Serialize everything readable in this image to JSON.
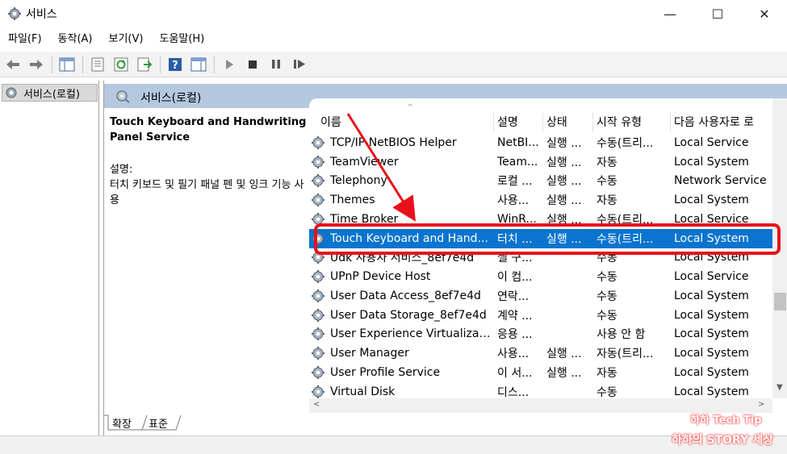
{
  "window": {
    "title": "서비스",
    "minimize": "—",
    "maximize": "☐",
    "close": "✕"
  },
  "menu": [
    "파일(F)",
    "동작(A)",
    "보기(V)",
    "도움말(H)"
  ],
  "tree": {
    "root_label": "서비스(로컬)"
  },
  "panel": {
    "header": "서비스(로컬)",
    "selected_name": "Touch Keyboard and Handwriting\nPanel Service",
    "desc_label": "설명:",
    "desc_text": "터치 키보드 및 필기 패널 펜 및 잉크 기능 사용"
  },
  "columns": [
    "이름",
    "설명",
    "상태",
    "시작 유형",
    "다음 사용자로 로"
  ],
  "rows": [
    {
      "name": "TCP/IP NetBIOS Helper",
      "desc": "NetBI...",
      "state": "실행 ...",
      "start": "수동(트리...",
      "logon": "Local Service"
    },
    {
      "name": "TeamViewer",
      "desc": "Team...",
      "state": "실행 ...",
      "start": "자동",
      "logon": "Local System"
    },
    {
      "name": "Telephony",
      "desc": "로컬 ...",
      "state": "실행 ...",
      "start": "수동",
      "logon": "Network Service"
    },
    {
      "name": "Themes",
      "desc": "사용...",
      "state": "실행 ...",
      "start": "자동",
      "logon": "Local System"
    },
    {
      "name": "Time Broker",
      "desc": "WinR...",
      "state": "실행 ...",
      "start": "수동(트리...",
      "logon": "Local Service"
    },
    {
      "name": "Touch Keyboard and Hand...",
      "desc": "터치 ...",
      "state": "실행 ...",
      "start": "수동(트리...",
      "logon": "Local System"
    },
    {
      "name": "Udk 사용자 서비스_8ef7e4d",
      "desc": "셸 구...",
      "state": "",
      "start": "수동",
      "logon": "Local System"
    },
    {
      "name": "UPnP Device Host",
      "desc": "이 컴...",
      "state": "",
      "start": "수동",
      "logon": "Local Service"
    },
    {
      "name": "User Data Access_8ef7e4d",
      "desc": "연락...",
      "state": "",
      "start": "수동",
      "logon": "Local System"
    },
    {
      "name": "User Data Storage_8ef7e4d",
      "desc": "계약 ...",
      "state": "",
      "start": "수동",
      "logon": "Local System"
    },
    {
      "name": "User Experience Virtualizatio...",
      "desc": "응용 ...",
      "state": "",
      "start": "사용 안 함",
      "logon": "Local System"
    },
    {
      "name": "User Manager",
      "desc": "사용...",
      "state": "실행 ...",
      "start": "자동(트리...",
      "logon": "Local System"
    },
    {
      "name": "User Profile Service",
      "desc": "이 서...",
      "state": "실행 ...",
      "start": "자동",
      "logon": "Local System"
    },
    {
      "name": "Virtual Disk",
      "desc": "디스...",
      "state": "",
      "start": "수동",
      "logon": "Local System"
    }
  ],
  "selected_index": 5,
  "tabs": [
    "확장",
    "표준"
  ],
  "watermark": {
    "line1": "하하 Tech Tip",
    "line2": "하하의 STORY 세상"
  },
  "colors": {
    "selection": "#0a74cf",
    "header_band": "#b4c8df",
    "annotation": "#e8111b"
  }
}
